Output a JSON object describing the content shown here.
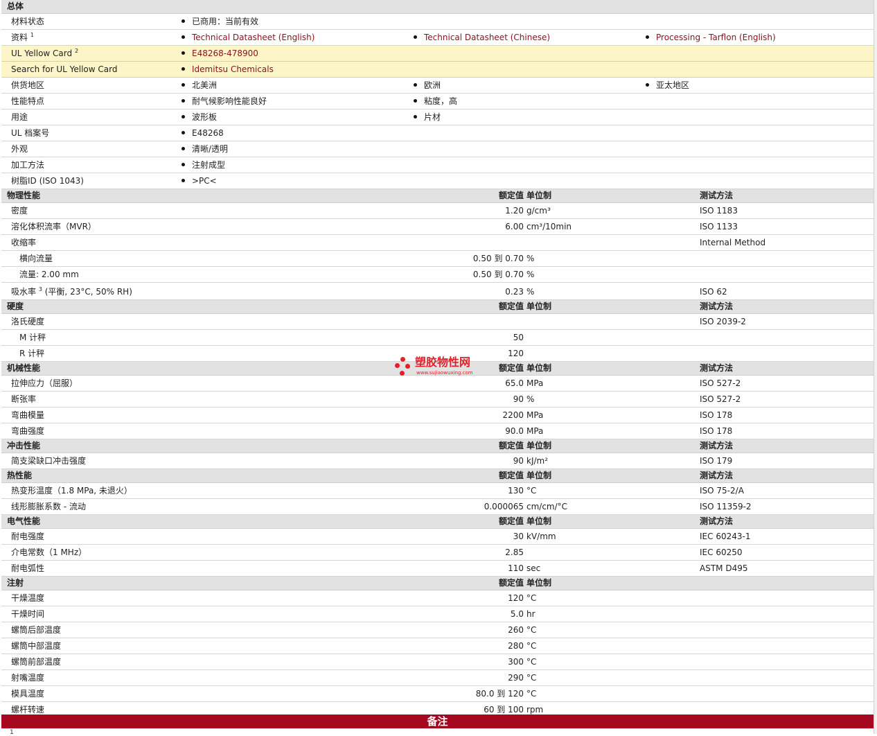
{
  "general": {
    "title": "总体",
    "rows": [
      {
        "label": "材料状态",
        "items": [
          "已商用：当前有效"
        ],
        "links": false
      },
      {
        "label": "资料",
        "sup": "1",
        "items": [
          "Technical Datasheet (English)",
          "Technical Datasheet (Chinese)",
          "Processing - Tarflon (English)"
        ],
        "links": true
      },
      {
        "label": "UL Yellow Card",
        "sup": "2",
        "items": [
          "E48268-478900"
        ],
        "links": true,
        "yellow": true
      },
      {
        "label": "Search for UL Yellow Card",
        "items": [
          "Idemitsu Chemicals"
        ],
        "links": true,
        "yellow": true
      },
      {
        "label": "供货地区",
        "items": [
          "北美洲",
          "欧洲",
          "亚太地区"
        ],
        "links": false
      },
      {
        "label": "性能特点",
        "items": [
          "耐气候影响性能良好",
          "粘度，高"
        ],
        "links": false
      },
      {
        "label": "用途",
        "items": [
          "波形板",
          "片材"
        ],
        "links": false
      },
      {
        "label": "UL 档案号",
        "items": [
          "E48268"
        ],
        "links": false
      },
      {
        "label": "外观",
        "items": [
          "清晰/透明"
        ],
        "links": false
      },
      {
        "label": "加工方法",
        "items": [
          "注射成型"
        ],
        "links": false
      },
      {
        "label": "树脂ID (ISO 1043)",
        "items": [
          ">PC<"
        ],
        "links": false
      }
    ]
  },
  "columns": {
    "value": "额定值",
    "unit": "单位制",
    "method": "测试方法"
  },
  "sections": [
    {
      "title": "物理性能",
      "show_method": true,
      "rows": [
        {
          "label": "密度",
          "value": "1.20",
          "unit": "g/cm³",
          "method": "ISO 1183"
        },
        {
          "label": "溶化体积流率（MVR）",
          "value": "6.00",
          "unit": "cm³/10min",
          "method": "ISO 1133"
        },
        {
          "label": "收缩率",
          "value": "",
          "unit": "",
          "method": "Internal Method"
        },
        {
          "label": "横向流量",
          "sub": true,
          "value": "0.50 到  0.70",
          "unit": "%",
          "method": ""
        },
        {
          "label": "流量: 2.00 mm",
          "sub": true,
          "value": "0.50 到  0.70",
          "unit": "%",
          "method": ""
        },
        {
          "label": "吸水率",
          "sup": "3",
          "label_tail": " (平衡, 23°C, 50% RH)",
          "value": "0.23",
          "unit": "%",
          "method": "ISO 62",
          "tall": true
        }
      ]
    },
    {
      "title": "硬度",
      "show_method": true,
      "rows": [
        {
          "label": "洛氏硬度",
          "value": "",
          "unit": "",
          "method": "ISO 2039-2"
        },
        {
          "label": "M 计秤",
          "sub": true,
          "value": "50",
          "unit": "",
          "method": ""
        },
        {
          "label": "R 计秤",
          "sub": true,
          "value": "120",
          "unit": "",
          "method": ""
        }
      ]
    },
    {
      "title": "机械性能",
      "show_method": true,
      "rows": [
        {
          "label": "拉伸应力（屈服）",
          "value": "65.0",
          "unit": "MPa",
          "method": "ISO 527-2"
        },
        {
          "label": "断张率",
          "value": "90",
          "unit": "%",
          "method": "ISO 527-2"
        },
        {
          "label": "弯曲模量",
          "value": "2200",
          "unit": "MPa",
          "method": "ISO 178"
        },
        {
          "label": "弯曲强度",
          "value": "90.0",
          "unit": "MPa",
          "method": "ISO 178"
        }
      ]
    },
    {
      "title": "冲击性能",
      "show_method": true,
      "rows": [
        {
          "label": "简支梁缺口冲击强度",
          "value": "90",
          "unit": "kJ/m²",
          "method": "ISO 179"
        }
      ]
    },
    {
      "title": "热性能",
      "show_method": true,
      "rows": [
        {
          "label": "热变形温度（1.8 MPa, 未退火）",
          "value": "130",
          "unit": "°C",
          "method": "ISO 75-2/A"
        },
        {
          "label": "线形膨胀系数  - 流动",
          "value": "0.000065",
          "unit": "cm/cm/°C",
          "method": "ISO 11359-2"
        }
      ]
    },
    {
      "title": "电气性能",
      "show_method": true,
      "rows": [
        {
          "label": "耐电强度",
          "value": "30",
          "unit": "kV/mm",
          "method": "IEC 60243-1"
        },
        {
          "label": "介电常数（1 MHz）",
          "value": "2.85",
          "unit": "",
          "method": "IEC 60250"
        },
        {
          "label": "耐电弧性",
          "value": "110",
          "unit": "sec",
          "method": "ASTM D495"
        }
      ]
    },
    {
      "title": "注射",
      "show_method": false,
      "rows": [
        {
          "label": "干燥温度",
          "value": "120",
          "unit": "°C",
          "method": ""
        },
        {
          "label": "干燥时间",
          "value": "5.0",
          "unit": "hr",
          "method": ""
        },
        {
          "label": "螺筒后部温度",
          "value": "260",
          "unit": "°C",
          "method": ""
        },
        {
          "label": "螺筒中部温度",
          "value": "280",
          "unit": "°C",
          "method": ""
        },
        {
          "label": "螺筒前部温度",
          "value": "300",
          "unit": "°C",
          "method": ""
        },
        {
          "label": "射嘴温度",
          "value": "290",
          "unit": "°C",
          "method": ""
        },
        {
          "label": "模具温度",
          "value": "80.0 到  120",
          "unit": "°C",
          "method": ""
        },
        {
          "label": "螺杆转速",
          "value": "60 到  100",
          "unit": "rpm",
          "method": ""
        }
      ]
    }
  ],
  "notes": {
    "title": "备注",
    "first_number": "1"
  },
  "watermark": {
    "title": "塑胶物性网",
    "url": "www.sujiaowuxing.com",
    "color": "#e3202a"
  },
  "colors": {
    "link": "#8c0f1f",
    "header_bg": "#e2e2e2",
    "yellow_bg": "#fbf5c8",
    "notes_bg": "#a5081e"
  }
}
